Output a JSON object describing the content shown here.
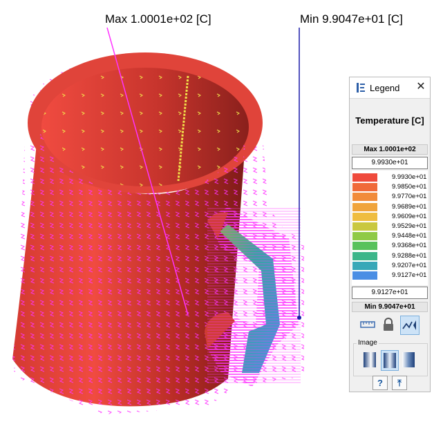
{
  "annotations": {
    "max_label": "Max  1.0001e+02  [C]",
    "min_label": "Min  9.9047e+01  [C]"
  },
  "legend": {
    "title": "Legend",
    "close_glyph": "✕",
    "quantity": "Temperature [C]",
    "max_text": "Max  1.0001e+02",
    "min_text": "Min  9.9047e+01",
    "upper_value": "9.9930e+01",
    "lower_value": "9.9127e+01",
    "scale": [
      {
        "label": "9.9930e+01",
        "color": "#ef4a3c"
      },
      {
        "label": "9.9850e+01",
        "color": "#f06a3a"
      },
      {
        "label": "9.9770e+01",
        "color": "#f18b3a"
      },
      {
        "label": "9.9689e+01",
        "color": "#f0a43c"
      },
      {
        "label": "9.9609e+01",
        "color": "#efbd3f"
      },
      {
        "label": "9.9529e+01",
        "color": "#c9c83f"
      },
      {
        "label": "9.9448e+01",
        "color": "#8fca46"
      },
      {
        "label": "9.9368e+01",
        "color": "#58c25c"
      },
      {
        "label": "9.9288e+01",
        "color": "#3cb68a"
      },
      {
        "label": "9.9207e+01",
        "color": "#38a8b8"
      },
      {
        "label": "9.9127e+01",
        "color": "#4a8ee4"
      }
    ],
    "image_group_label": "Image",
    "help_glyph": "?",
    "export_glyph": "⤒",
    "icons": [
      "legend-icon",
      "close-icon",
      "ruler-icon",
      "lock-icon",
      "plot-icon",
      "gradient-icon",
      "help-icon",
      "export-icon"
    ]
  }
}
